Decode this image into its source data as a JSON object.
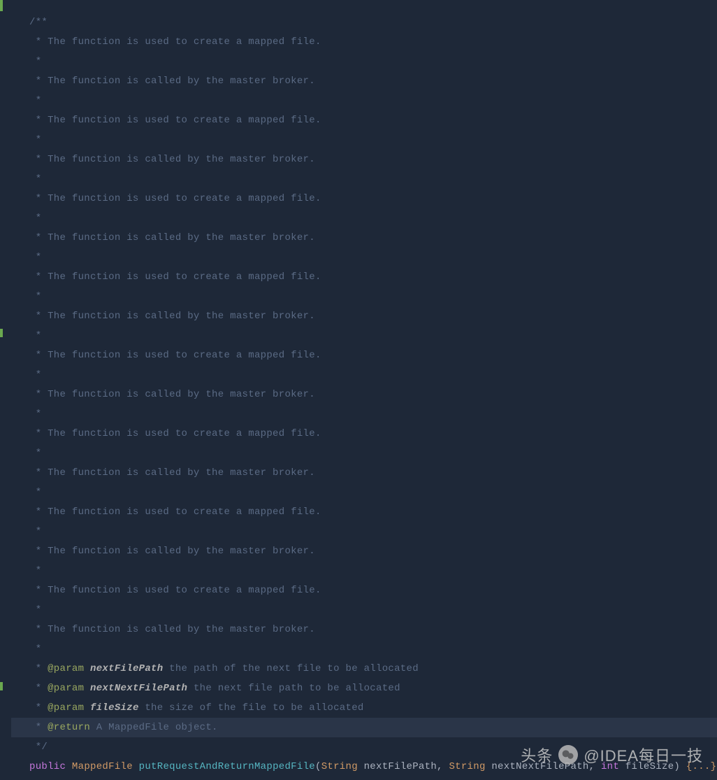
{
  "code": {
    "comment_open": "/**",
    "comment_create": " * The function is used to create a mapped file.",
    "comment_called": " * The function is called by the master broker.",
    "comment_star": " *",
    "param_tag": "@param",
    "return_tag": "@return",
    "params": [
      {
        "name": "nextFilePath",
        "desc": " the path of the next file to be allocated"
      },
      {
        "name": "nextNextFilePath",
        "desc": " the next file path to be allocated"
      },
      {
        "name": "fileSize",
        "desc": " the size of the file to be allocated"
      }
    ],
    "return_desc": " A MappedFile object.",
    "comment_close": " */",
    "sig": {
      "modifier": "public",
      "ret_type": "MappedFile",
      "method": "putRequestAndReturnMappedFile",
      "paren_open": "(",
      "p1_type": "String",
      "p1_name": " nextFilePath, ",
      "p2_type": "String",
      "p2_name": " nextNextFilePath, ",
      "p3_type": "int",
      "p3_name": " fileSize) ",
      "fold": "{...}"
    }
  },
  "watermark": {
    "prefix": "头条",
    "handle": "@IDEA每日一技"
  }
}
